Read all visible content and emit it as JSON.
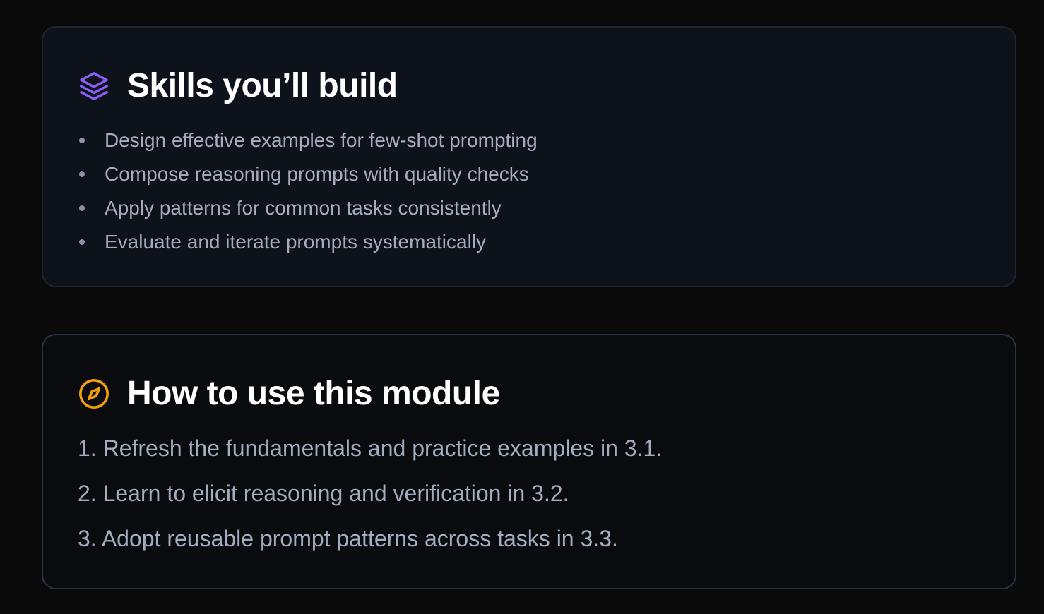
{
  "skills": {
    "title": "Skills you’ll build",
    "icon": "layers-icon",
    "icon_color": "#8b5cf6",
    "items": [
      "Design effective examples for few-shot prompting",
      "Compose reasoning prompts with quality checks",
      "Apply patterns for common tasks consistently",
      "Evaluate and iterate prompts systematically"
    ]
  },
  "howto": {
    "title": "How to use this module",
    "icon": "compass-icon",
    "icon_color": "#f59e0b",
    "steps": [
      "1. Refresh the fundamentals and practice examples in 3.1.",
      "2. Learn to elicit reasoning and verification in 3.2.",
      "3. Adopt reusable prompt patterns across tasks in 3.3."
    ]
  }
}
